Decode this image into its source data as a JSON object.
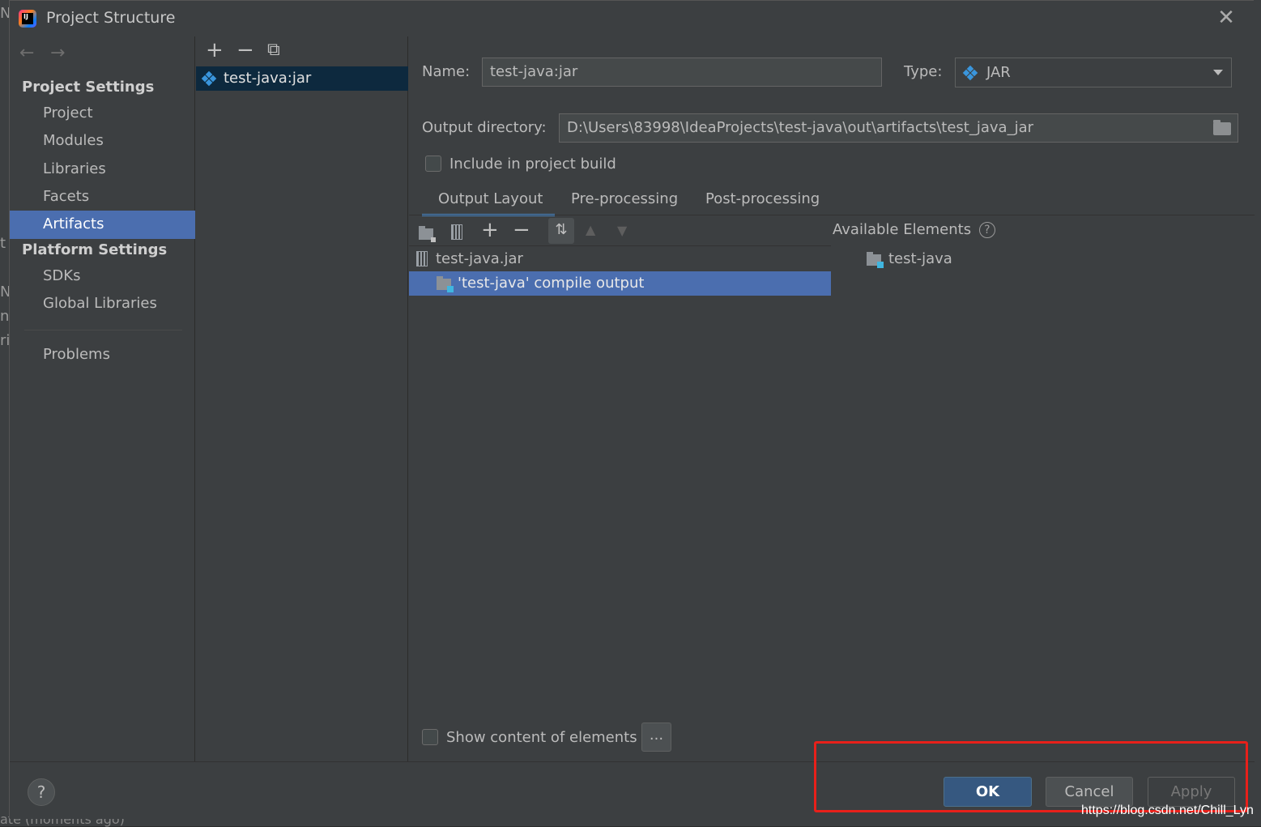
{
  "window": {
    "title": "Project Structure"
  },
  "sidebar": {
    "project_settings_heading": "Project Settings",
    "project_items": [
      "Project",
      "Modules",
      "Libraries",
      "Facets",
      "Artifacts"
    ],
    "selected_item": "Artifacts",
    "platform_settings_heading": "Platform Settings",
    "platform_items": [
      "SDKs",
      "Global Libraries"
    ],
    "problems_label": "Problems"
  },
  "artifacts": {
    "toolbar_icons": [
      "add-icon",
      "remove-icon",
      "copy-icon"
    ],
    "items": [
      "test-java:jar"
    ]
  },
  "form": {
    "name_label": "Name:",
    "name_value": "test-java:jar",
    "type_label": "Type:",
    "type_value": "JAR",
    "output_dir_label": "Output directory:",
    "output_dir_value": "D:\\Users\\83998\\IdeaProjects\\test-java\\out\\artifacts\\test_java_jar",
    "include_label": "Include in project build",
    "include_checked": false
  },
  "tabs": [
    "Output Layout",
    "Pre-processing",
    "Post-processing"
  ],
  "active_tab": "Output Layout",
  "layout": {
    "root": "test-java.jar",
    "child": "'test-java' compile output",
    "available_title": "Available Elements",
    "available_items": [
      "test-java"
    ],
    "show_content_label": "Show content of elements",
    "show_content_checked": false,
    "ellipsis_label": "..."
  },
  "buttons": {
    "help": "?",
    "ok": "OK",
    "cancel": "Cancel",
    "apply": "Apply"
  },
  "colors": {
    "selection": "#4b6eaf",
    "ok_button": "#365880",
    "highlight_box": "#e8201a"
  },
  "watermark": "https://blog.csdn.net/Chill_Lyn",
  "background_ide": {
    "bottom_text": "ate (moments ago)"
  }
}
